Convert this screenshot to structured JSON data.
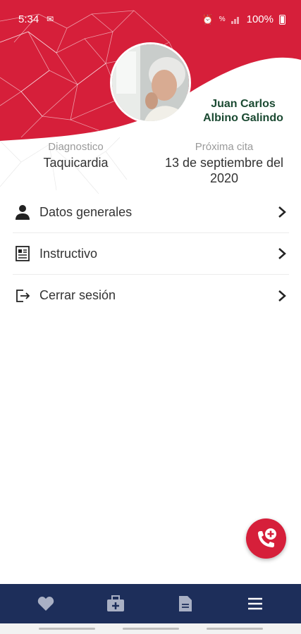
{
  "status_bar": {
    "time": "5:34",
    "battery": "100%"
  },
  "profile": {
    "name_line1": "Juan Carlos",
    "name_line2": "Albino Galindo"
  },
  "info": {
    "diagnosis_label": "Diagnostico",
    "diagnosis_value": "Taquicardia",
    "appointment_label": "Próxima cita",
    "appointment_value_line1": "13 de septiembre del",
    "appointment_value_line2": "2020"
  },
  "menu": {
    "items": [
      {
        "label": "Datos generales",
        "icon": "person-icon"
      },
      {
        "label": "Instructivo",
        "icon": "document-icon"
      },
      {
        "label": "Cerrar sesión",
        "icon": "logout-icon"
      }
    ]
  },
  "bottom_nav": {
    "items": [
      "heart-icon",
      "medical-bag-icon",
      "file-icon",
      "menu-icon"
    ],
    "active": "menu-icon"
  },
  "colors": {
    "brand_red": "#d61f3a",
    "nav_blue": "#1d2e5a",
    "name_green": "#1b4a32"
  }
}
